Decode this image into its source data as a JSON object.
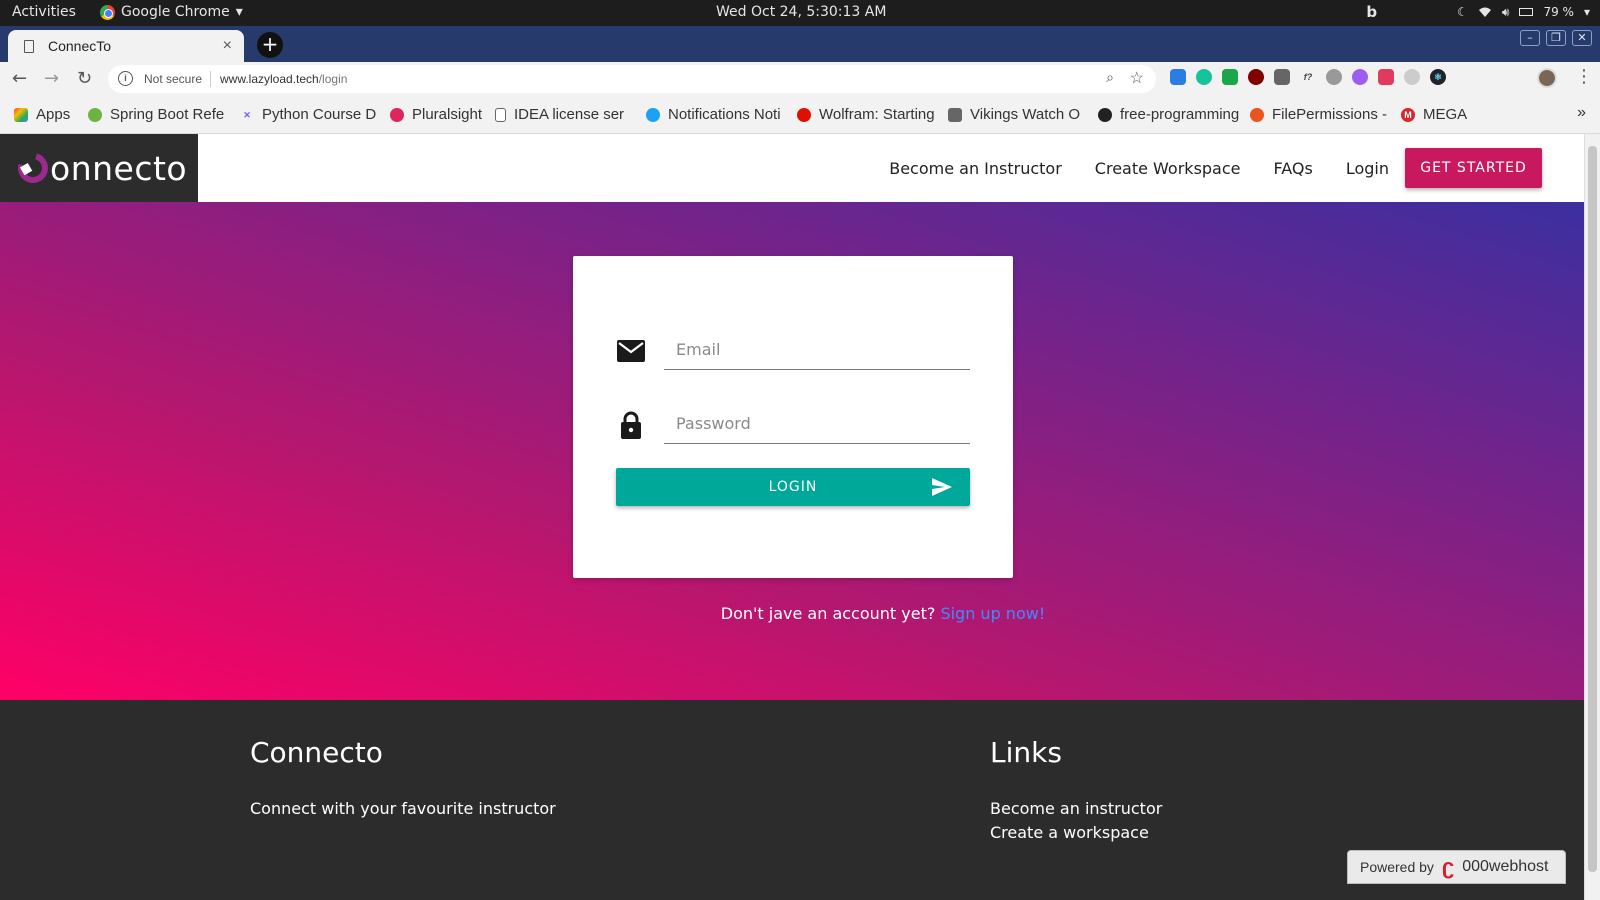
{
  "os": {
    "activities": "Activities",
    "app_name": "Google Chrome",
    "app_menu_arrow": "▾",
    "clock": "Wed Oct 24,  5:30:13 AM",
    "battery": "79 %"
  },
  "browser": {
    "tab_title": "ConnecTo",
    "tab_close": "×",
    "new_tab": "+",
    "security_label": "Not secure",
    "url_host": "www.lazyload.tech",
    "url_path": "/login",
    "bookmarks": [
      {
        "label": "Apps",
        "icon": "apps-grid-icon",
        "color": "#e44"
      },
      {
        "label": "Spring Boot Refe",
        "icon": "spring-icon",
        "color": "#6db33f"
      },
      {
        "label": "Python Course D",
        "icon": "python-course-icon",
        "color": "#7a5cff"
      },
      {
        "label": "Pluralsight",
        "icon": "pluralsight-icon",
        "color": "#f15b2a"
      },
      {
        "label": "IDEA license ser",
        "icon": "document-icon",
        "color": "#777777"
      },
      {
        "label": "Notifications Noti",
        "icon": "twitter-icon",
        "color": "#1da1f2"
      },
      {
        "label": "Wolfram: Starting",
        "icon": "wolfram-icon",
        "color": "#dd1100"
      },
      {
        "label": "Vikings Watch O",
        "icon": "vikings-icon",
        "color": "#666666"
      },
      {
        "label": "free-programming",
        "icon": "github-icon",
        "color": "#222222"
      },
      {
        "label": "FilePermissions -",
        "icon": "ubuntu-icon",
        "color": "#e95420"
      },
      {
        "label": "MEGA",
        "icon": "mega-icon",
        "color": "#d9272e"
      }
    ],
    "bookmarks_more": "»"
  },
  "site": {
    "logo_text": "onnecto",
    "nav": {
      "become_instructor": "Become an Instructor",
      "create_workspace": "Create Workspace",
      "faqs": "FAQs",
      "login": "Login",
      "get_started": "GET STARTED"
    },
    "form": {
      "email_placeholder": "Email",
      "password_placeholder": "Password",
      "login_button": "LOGIN"
    },
    "signup_prompt": "Don't jave an account yet?",
    "signup_link": "Sign up now!",
    "footer": {
      "brand_title": "Connecto",
      "tagline": "Connect with your favourite instructor",
      "links_title": "Links",
      "links": [
        "Become an instructor",
        "Create a workspace"
      ]
    },
    "powered_by": "Powered by",
    "host_brand": "000webhost"
  },
  "colors": {
    "accent_pink": "#c8195f",
    "login_teal": "#00a89a",
    "signup_link_blue": "#3d8cff",
    "footer_bg": "#2c2c2c",
    "gradient": [
      "#ff0066",
      "#832084",
      "#3c2fa0"
    ]
  }
}
